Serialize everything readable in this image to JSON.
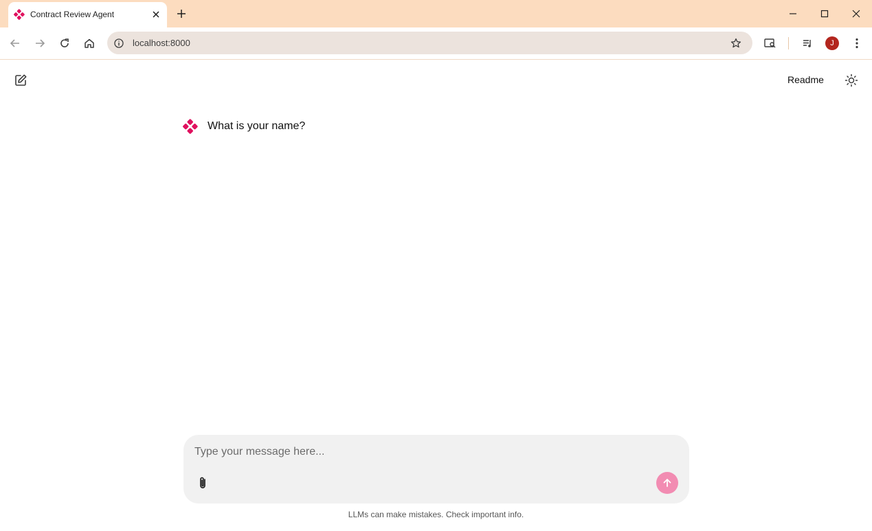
{
  "browser": {
    "tab": {
      "title": "Contract Review Agent",
      "favicon": "pinwheel-logo-icon"
    },
    "address_bar": {
      "url": "localhost:8000"
    },
    "profile_initial": "J"
  },
  "header": {
    "new_chat_icon": "edit-icon",
    "readme_label": "Readme",
    "theme_icon": "sun-icon"
  },
  "chat": {
    "messages": [
      {
        "role": "assistant",
        "text": "What is your name?"
      }
    ]
  },
  "composer": {
    "placeholder": "Type your message here...",
    "value": "",
    "attach_icon": "paperclip-icon",
    "send_icon": "arrow-up-icon"
  },
  "footer": {
    "disclaimer": "LLMs can make mistakes. Check important info."
  },
  "colors": {
    "brand": "#e0115f",
    "tab_strip": "#fcdcbf",
    "send_button": "#f28cb2",
    "composer_bg": "#f1f1f1"
  }
}
